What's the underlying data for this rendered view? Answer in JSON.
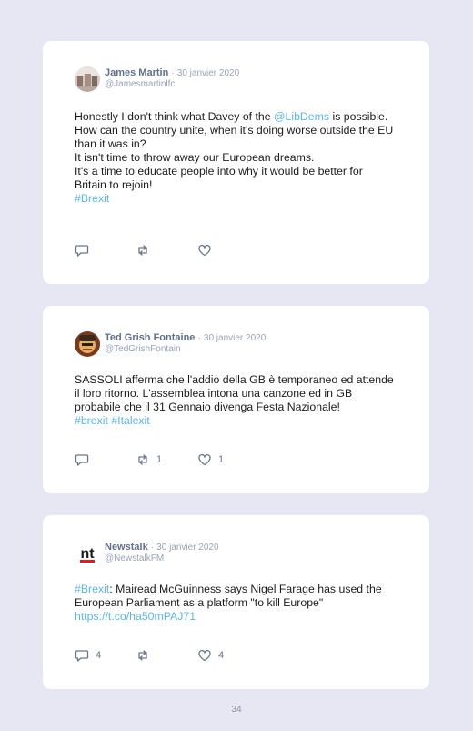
{
  "colors": {
    "background": "#e6e7f3",
    "link": "#5bb6e6",
    "icon": "#6b7488"
  },
  "tweets": [
    {
      "name": "James Martin",
      "separator": "·",
      "date": "30 janvier 2020",
      "handle": "@Jamesmartinlfc",
      "lines": [
        {
          "pre": "Honestly I don't think what Davey of the ",
          "mention": "@LibDems",
          "post": " is possible."
        },
        {
          "pre": "How can the country unite, when it's doing worse outside the EU than it was in?"
        },
        {
          "pre": "It isn't time to throw away our European dreams."
        },
        {
          "pre": "It's a time to educate people into why it would be better for Britain to rejoin!"
        }
      ],
      "hashtags": "#Brexit",
      "reply_count": "",
      "retweet_count": "",
      "like_count": ""
    },
    {
      "name": "Ted Grish Fontaine",
      "separator": "·",
      "date": "30 janvier 2020",
      "handle": "@TedGrishFontain",
      "text": "SASSOLI afferma che l'addio della GB è temporaneo ed attende il loro ritorno. L'assemblea intona una canzone ed in GB probabile che il 31 Gennaio divenga Festa Nazionale!",
      "hashtags": "#brexit #Italexit",
      "reply_count": "",
      "retweet_count": "1",
      "like_count": "1"
    },
    {
      "name": "Newstalk",
      "separator": "·",
      "date": "30 janvier 2020",
      "handle": "@NewstalkFM",
      "logo_text": "nt",
      "hashtag_lead": "#Brexit",
      "text": ": Mairead McGuinness says Nigel Farage has used the European Parliament as a platform \"to kill Europe\"",
      "url": "https://t.co/ha50mPAJ71",
      "reply_count": "4",
      "retweet_count": "",
      "like_count": "4"
    }
  ],
  "page_number": "34"
}
